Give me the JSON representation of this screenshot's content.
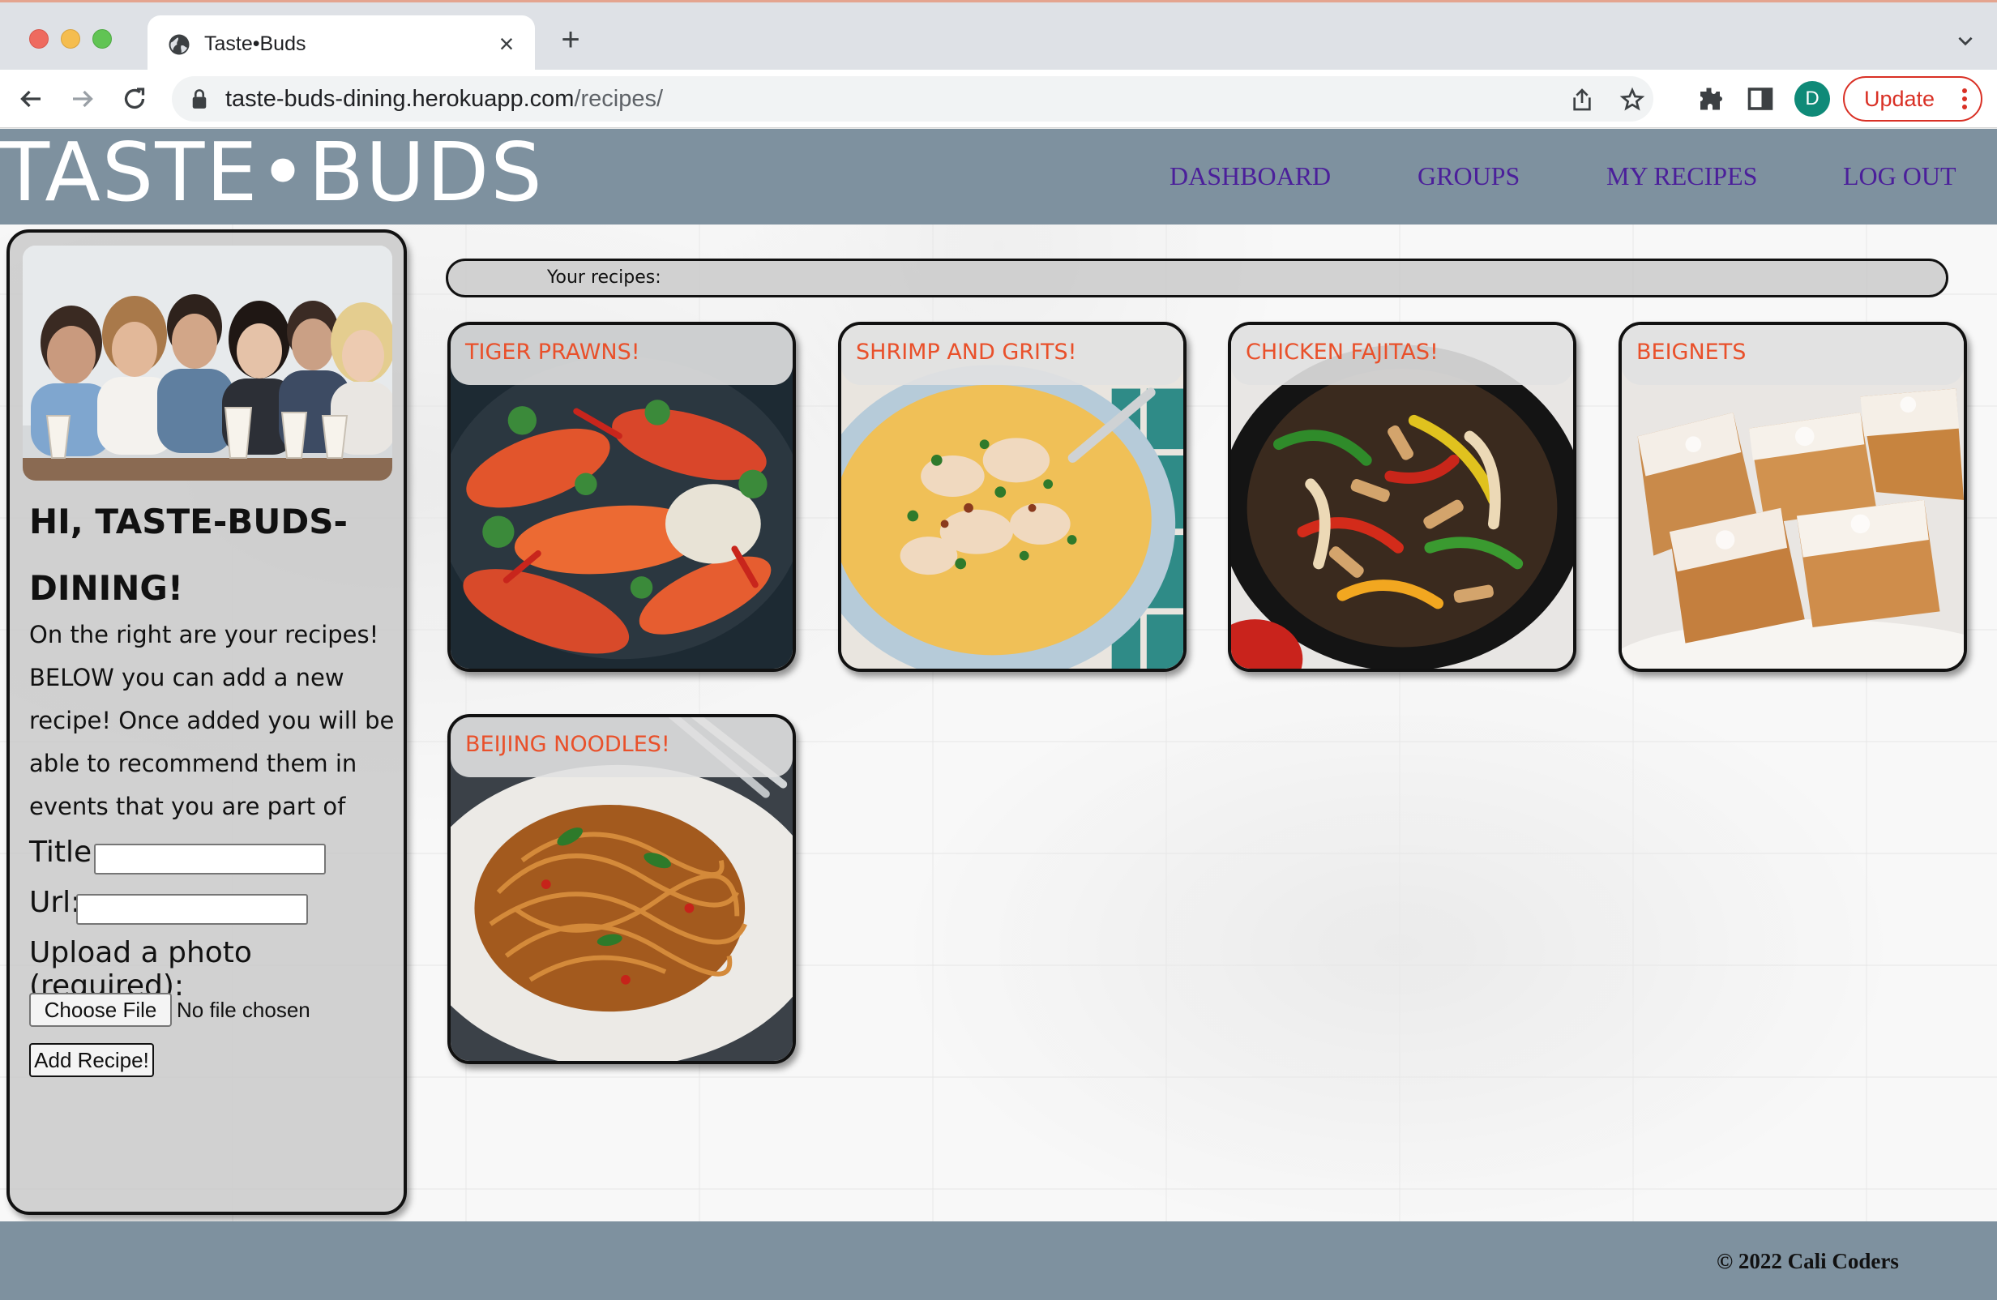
{
  "browser": {
    "tab_title": "Taste•Buds",
    "url_host": "taste-buds-dining.herokuapp.com",
    "url_path": "/recipes/",
    "avatar_letter": "D",
    "update_label": "Update",
    "icons": [
      "globe-icon",
      "close-icon",
      "plus-icon",
      "chevron-down-icon",
      "back-icon",
      "forward-icon",
      "reload-icon",
      "lock-icon",
      "share-icon",
      "star-icon",
      "extensions-icon",
      "side-panel-icon",
      "more-vert-icon"
    ]
  },
  "site": {
    "brand": "TASTE•BUDS",
    "nav": [
      {
        "label": "DASHBOARD"
      },
      {
        "label": "GROUPS"
      },
      {
        "label": "MY RECIPES"
      },
      {
        "label": "LOG OUT"
      }
    ]
  },
  "sidebar": {
    "greeting": "HI, TASTE-BUDS-DINING!",
    "description": "On the right are your recipes! BELOW you can add a new recipe! Once added you will be able to recommend them in events that you are part of",
    "form": {
      "title_label": "Title:",
      "title_value": "",
      "url_label": "Url:",
      "url_value": "",
      "photo_label": "Upload a photo (required):",
      "file_button": "Choose File",
      "file_status": "No file chosen",
      "submit_label": "Add Recipe!"
    }
  },
  "recipes": {
    "heading": "Your recipes:",
    "items": [
      {
        "title": "TIGER PRAWNS!"
      },
      {
        "title": "SHRIMP AND GRITS!"
      },
      {
        "title": "CHICKEN FAJITAS!"
      },
      {
        "title": "BEIGNETS"
      },
      {
        "title": "BEIJING NOODLES!"
      }
    ]
  },
  "footer": {
    "copyright": "© 2022 Cali Coders"
  },
  "colors": {
    "header_bg": "#7e919f",
    "nav_link": "#4b1f9a",
    "recipe_title": "#e9502a",
    "update_red": "#d93025",
    "avatar_bg": "#0f8a78"
  }
}
